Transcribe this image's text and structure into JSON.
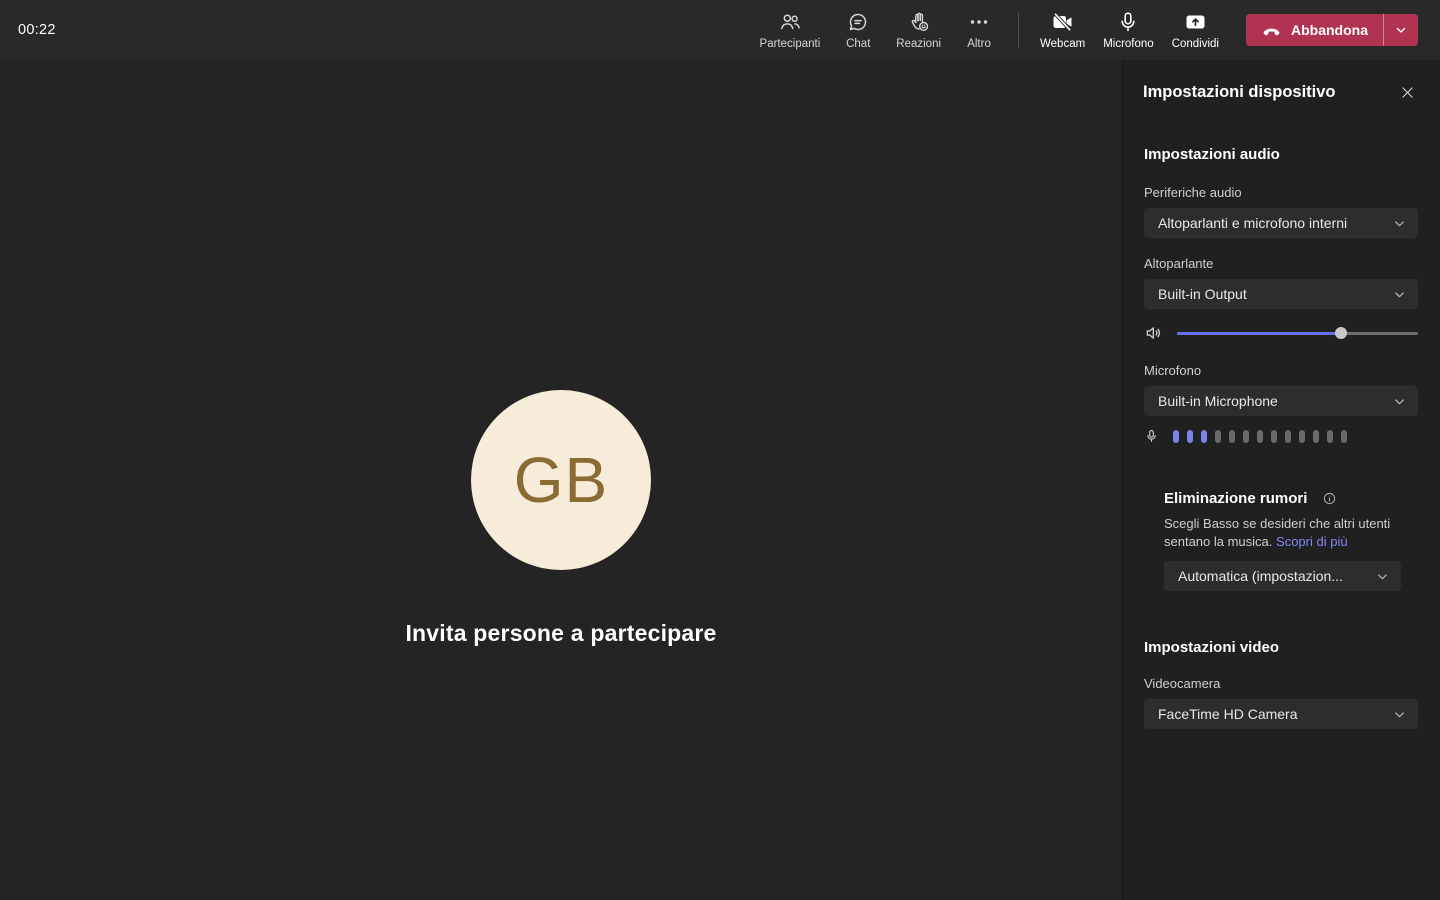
{
  "topbar": {
    "timer": "00:22",
    "items": [
      {
        "label": "Partecipanti"
      },
      {
        "label": "Chat"
      },
      {
        "label": "Reazioni"
      },
      {
        "label": "Altro"
      },
      {
        "label": "Webcam"
      },
      {
        "label": "Microfono"
      },
      {
        "label": "Condividi"
      }
    ],
    "leave_button": {
      "label": "Abbandona"
    }
  },
  "stage": {
    "avatar_initials": "GB",
    "invite_text": "Invita persone a partecipare"
  },
  "panel": {
    "title": "Impostazioni dispositivo",
    "audio_section": {
      "heading": "Impostazioni audio",
      "devices_label": "Periferiche audio",
      "devices_value": "Altoparlanti e microfono interni",
      "speaker_label": "Altoparlante",
      "speaker_value": "Built-in Output",
      "volume_percent": 68,
      "microphone_label": "Microfono",
      "microphone_value": "Built-in Microphone",
      "mic_meter": {
        "total": 13,
        "active": 3
      },
      "noise": {
        "title": "Eliminazione rumori",
        "description": "Scegli Basso se desideri che altri utenti sentano la musica.",
        "link_label": "Scopri di più",
        "value": "Automatica (impostazion..."
      }
    },
    "video_section": {
      "heading": "Impostazioni video",
      "camera_label": "Videocamera",
      "camera_value": "FaceTime HD Camera"
    }
  },
  "colors": {
    "accent": "#7b83eb",
    "slider_fill": "#6b70e0",
    "leave_red": "#b03452",
    "link": "#7f87f2",
    "avatar_bg": "#f7ecda",
    "avatar_text": "#8a6b34"
  }
}
